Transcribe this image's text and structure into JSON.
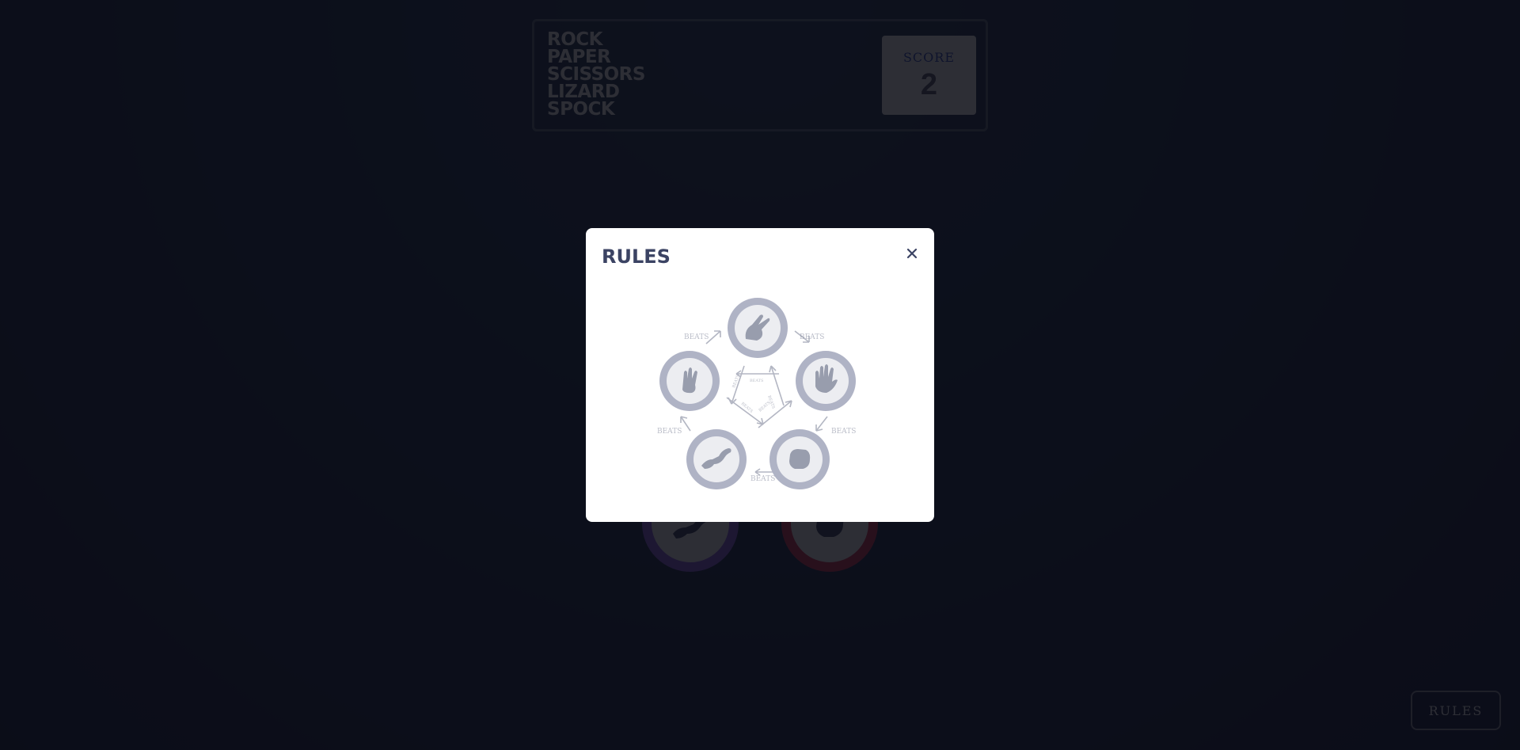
{
  "header": {
    "title_lines": [
      "ROCK",
      "PAPER",
      "SCISSORS",
      "LIZARD",
      "SPOCK"
    ],
    "score_label": "SCORE",
    "score_value": "2"
  },
  "picks": {
    "player": "lizard",
    "house": "rock"
  },
  "rules_button": {
    "label": "RULES"
  },
  "modal": {
    "title": "RULES",
    "close_icon": "close-icon",
    "diagram": {
      "nodes": [
        {
          "name": "scissors",
          "icon": "scissors-hand-icon"
        },
        {
          "name": "paper",
          "icon": "paper-hand-icon"
        },
        {
          "name": "rock",
          "icon": "rock-fist-icon"
        },
        {
          "name": "lizard",
          "icon": "lizard-icon"
        },
        {
          "name": "spock",
          "icon": "spock-hand-icon"
        }
      ],
      "beats_label": "BEATS"
    }
  },
  "colors": {
    "dark_text": "#3b4363",
    "score_text": "#2a46c0",
    "lizard_ring": "#8c5de5",
    "rock_ring": "#dc2e4e"
  }
}
